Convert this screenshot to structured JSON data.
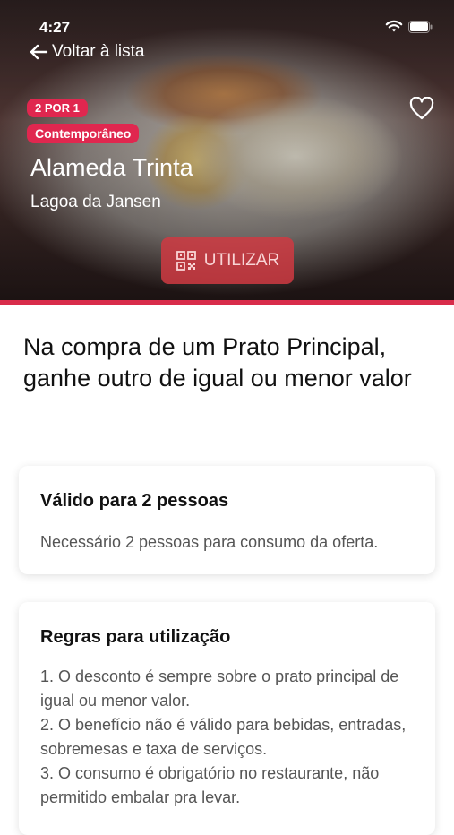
{
  "status": {
    "time": "4:27"
  },
  "header": {
    "back_label": "Voltar à lista"
  },
  "restaurant": {
    "badge_offer": "2 POR 1",
    "badge_category": "Contemporâneo",
    "name": "Alameda Trinta",
    "location": "Lagoa da Jansen"
  },
  "actions": {
    "use_label": "UTILIZAR"
  },
  "offer": {
    "headline": "Na compra de um Prato Principal, ganhe outro de igual ou menor valor"
  },
  "validity": {
    "title": "Válido para 2 pessoas",
    "text": "Necessário 2 pessoas para consumo da oferta."
  },
  "rules": {
    "title": "Regras para utilização",
    "items": [
      "1. O desconto é sempre sobre o prato principal de igual ou menor valor.",
      "2. O benefício não é válido para bebidas, entradas, sobremesas e taxa de serviços.",
      "3. O consumo é obrigatório no restaurante, não permitido embalar pra levar."
    ]
  },
  "colors": {
    "accent": "#e0274f",
    "button": "#cf3942"
  }
}
